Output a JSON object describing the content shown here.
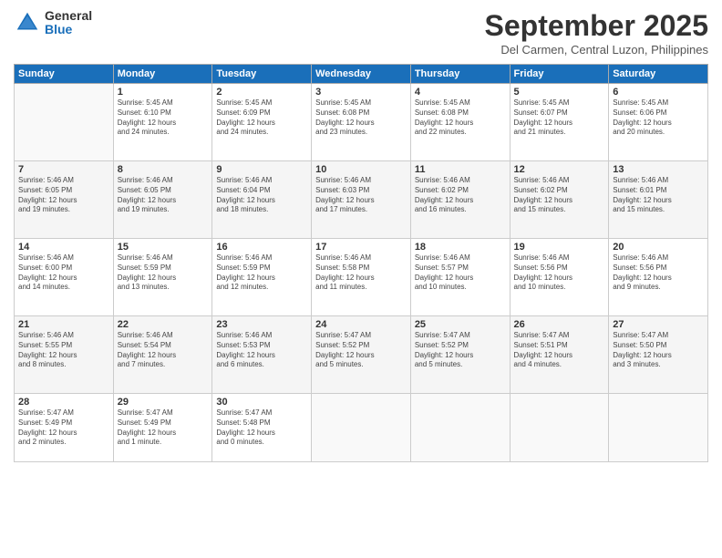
{
  "logo": {
    "general": "General",
    "blue": "Blue"
  },
  "title": "September 2025",
  "subtitle": "Del Carmen, Central Luzon, Philippines",
  "headers": [
    "Sunday",
    "Monday",
    "Tuesday",
    "Wednesday",
    "Thursday",
    "Friday",
    "Saturday"
  ],
  "weeks": [
    [
      {
        "day": "",
        "info": ""
      },
      {
        "day": "1",
        "info": "Sunrise: 5:45 AM\nSunset: 6:10 PM\nDaylight: 12 hours\nand 24 minutes."
      },
      {
        "day": "2",
        "info": "Sunrise: 5:45 AM\nSunset: 6:09 PM\nDaylight: 12 hours\nand 24 minutes."
      },
      {
        "day": "3",
        "info": "Sunrise: 5:45 AM\nSunset: 6:08 PM\nDaylight: 12 hours\nand 23 minutes."
      },
      {
        "day": "4",
        "info": "Sunrise: 5:45 AM\nSunset: 6:08 PM\nDaylight: 12 hours\nand 22 minutes."
      },
      {
        "day": "5",
        "info": "Sunrise: 5:45 AM\nSunset: 6:07 PM\nDaylight: 12 hours\nand 21 minutes."
      },
      {
        "day": "6",
        "info": "Sunrise: 5:45 AM\nSunset: 6:06 PM\nDaylight: 12 hours\nand 20 minutes."
      }
    ],
    [
      {
        "day": "7",
        "info": "Sunrise: 5:46 AM\nSunset: 6:05 PM\nDaylight: 12 hours\nand 19 minutes."
      },
      {
        "day": "8",
        "info": "Sunrise: 5:46 AM\nSunset: 6:05 PM\nDaylight: 12 hours\nand 19 minutes."
      },
      {
        "day": "9",
        "info": "Sunrise: 5:46 AM\nSunset: 6:04 PM\nDaylight: 12 hours\nand 18 minutes."
      },
      {
        "day": "10",
        "info": "Sunrise: 5:46 AM\nSunset: 6:03 PM\nDaylight: 12 hours\nand 17 minutes."
      },
      {
        "day": "11",
        "info": "Sunrise: 5:46 AM\nSunset: 6:02 PM\nDaylight: 12 hours\nand 16 minutes."
      },
      {
        "day": "12",
        "info": "Sunrise: 5:46 AM\nSunset: 6:02 PM\nDaylight: 12 hours\nand 15 minutes."
      },
      {
        "day": "13",
        "info": "Sunrise: 5:46 AM\nSunset: 6:01 PM\nDaylight: 12 hours\nand 15 minutes."
      }
    ],
    [
      {
        "day": "14",
        "info": "Sunrise: 5:46 AM\nSunset: 6:00 PM\nDaylight: 12 hours\nand 14 minutes."
      },
      {
        "day": "15",
        "info": "Sunrise: 5:46 AM\nSunset: 5:59 PM\nDaylight: 12 hours\nand 13 minutes."
      },
      {
        "day": "16",
        "info": "Sunrise: 5:46 AM\nSunset: 5:59 PM\nDaylight: 12 hours\nand 12 minutes."
      },
      {
        "day": "17",
        "info": "Sunrise: 5:46 AM\nSunset: 5:58 PM\nDaylight: 12 hours\nand 11 minutes."
      },
      {
        "day": "18",
        "info": "Sunrise: 5:46 AM\nSunset: 5:57 PM\nDaylight: 12 hours\nand 10 minutes."
      },
      {
        "day": "19",
        "info": "Sunrise: 5:46 AM\nSunset: 5:56 PM\nDaylight: 12 hours\nand 10 minutes."
      },
      {
        "day": "20",
        "info": "Sunrise: 5:46 AM\nSunset: 5:56 PM\nDaylight: 12 hours\nand 9 minutes."
      }
    ],
    [
      {
        "day": "21",
        "info": "Sunrise: 5:46 AM\nSunset: 5:55 PM\nDaylight: 12 hours\nand 8 minutes."
      },
      {
        "day": "22",
        "info": "Sunrise: 5:46 AM\nSunset: 5:54 PM\nDaylight: 12 hours\nand 7 minutes."
      },
      {
        "day": "23",
        "info": "Sunrise: 5:46 AM\nSunset: 5:53 PM\nDaylight: 12 hours\nand 6 minutes."
      },
      {
        "day": "24",
        "info": "Sunrise: 5:47 AM\nSunset: 5:52 PM\nDaylight: 12 hours\nand 5 minutes."
      },
      {
        "day": "25",
        "info": "Sunrise: 5:47 AM\nSunset: 5:52 PM\nDaylight: 12 hours\nand 5 minutes."
      },
      {
        "day": "26",
        "info": "Sunrise: 5:47 AM\nSunset: 5:51 PM\nDaylight: 12 hours\nand 4 minutes."
      },
      {
        "day": "27",
        "info": "Sunrise: 5:47 AM\nSunset: 5:50 PM\nDaylight: 12 hours\nand 3 minutes."
      }
    ],
    [
      {
        "day": "28",
        "info": "Sunrise: 5:47 AM\nSunset: 5:49 PM\nDaylight: 12 hours\nand 2 minutes."
      },
      {
        "day": "29",
        "info": "Sunrise: 5:47 AM\nSunset: 5:49 PM\nDaylight: 12 hours\nand 1 minute."
      },
      {
        "day": "30",
        "info": "Sunrise: 5:47 AM\nSunset: 5:48 PM\nDaylight: 12 hours\nand 0 minutes."
      },
      {
        "day": "",
        "info": ""
      },
      {
        "day": "",
        "info": ""
      },
      {
        "day": "",
        "info": ""
      },
      {
        "day": "",
        "info": ""
      }
    ]
  ]
}
